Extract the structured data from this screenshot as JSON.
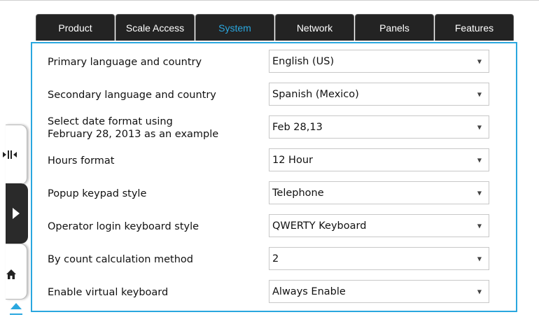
{
  "tabs": [
    {
      "label": "Product"
    },
    {
      "label": "Scale Access"
    },
    {
      "label": "System"
    },
    {
      "label": "Network"
    },
    {
      "label": "Panels"
    },
    {
      "label": "Features"
    }
  ],
  "active_tab": "System",
  "settings": [
    {
      "label": "Primary language and country",
      "value": "English (US)"
    },
    {
      "label": "Secondary language and country",
      "value": "Spanish (Mexico)"
    },
    {
      "label": "Select date format using\nFebruary 28, 2013 as an example",
      "value": "Feb 28,13"
    },
    {
      "label": "Hours format",
      "value": "12 Hour"
    },
    {
      "label": "Popup keypad style",
      "value": "Telephone"
    },
    {
      "label": "Operator login keyboard style",
      "value": "QWERTY Keyboard"
    },
    {
      "label": "By count calculation method",
      "value": "2"
    },
    {
      "label": "Enable virtual keyboard",
      "value": "Always Enable"
    }
  ],
  "side_icons": [
    "collapse-arrows-icon",
    "play-arrow-icon",
    "home-icon",
    "eject-icon"
  ],
  "colors": {
    "accent": "#2aa7df",
    "tab_bg": "#232323",
    "border": "#c8c8c8"
  },
  "dropdown_caret": "▼"
}
